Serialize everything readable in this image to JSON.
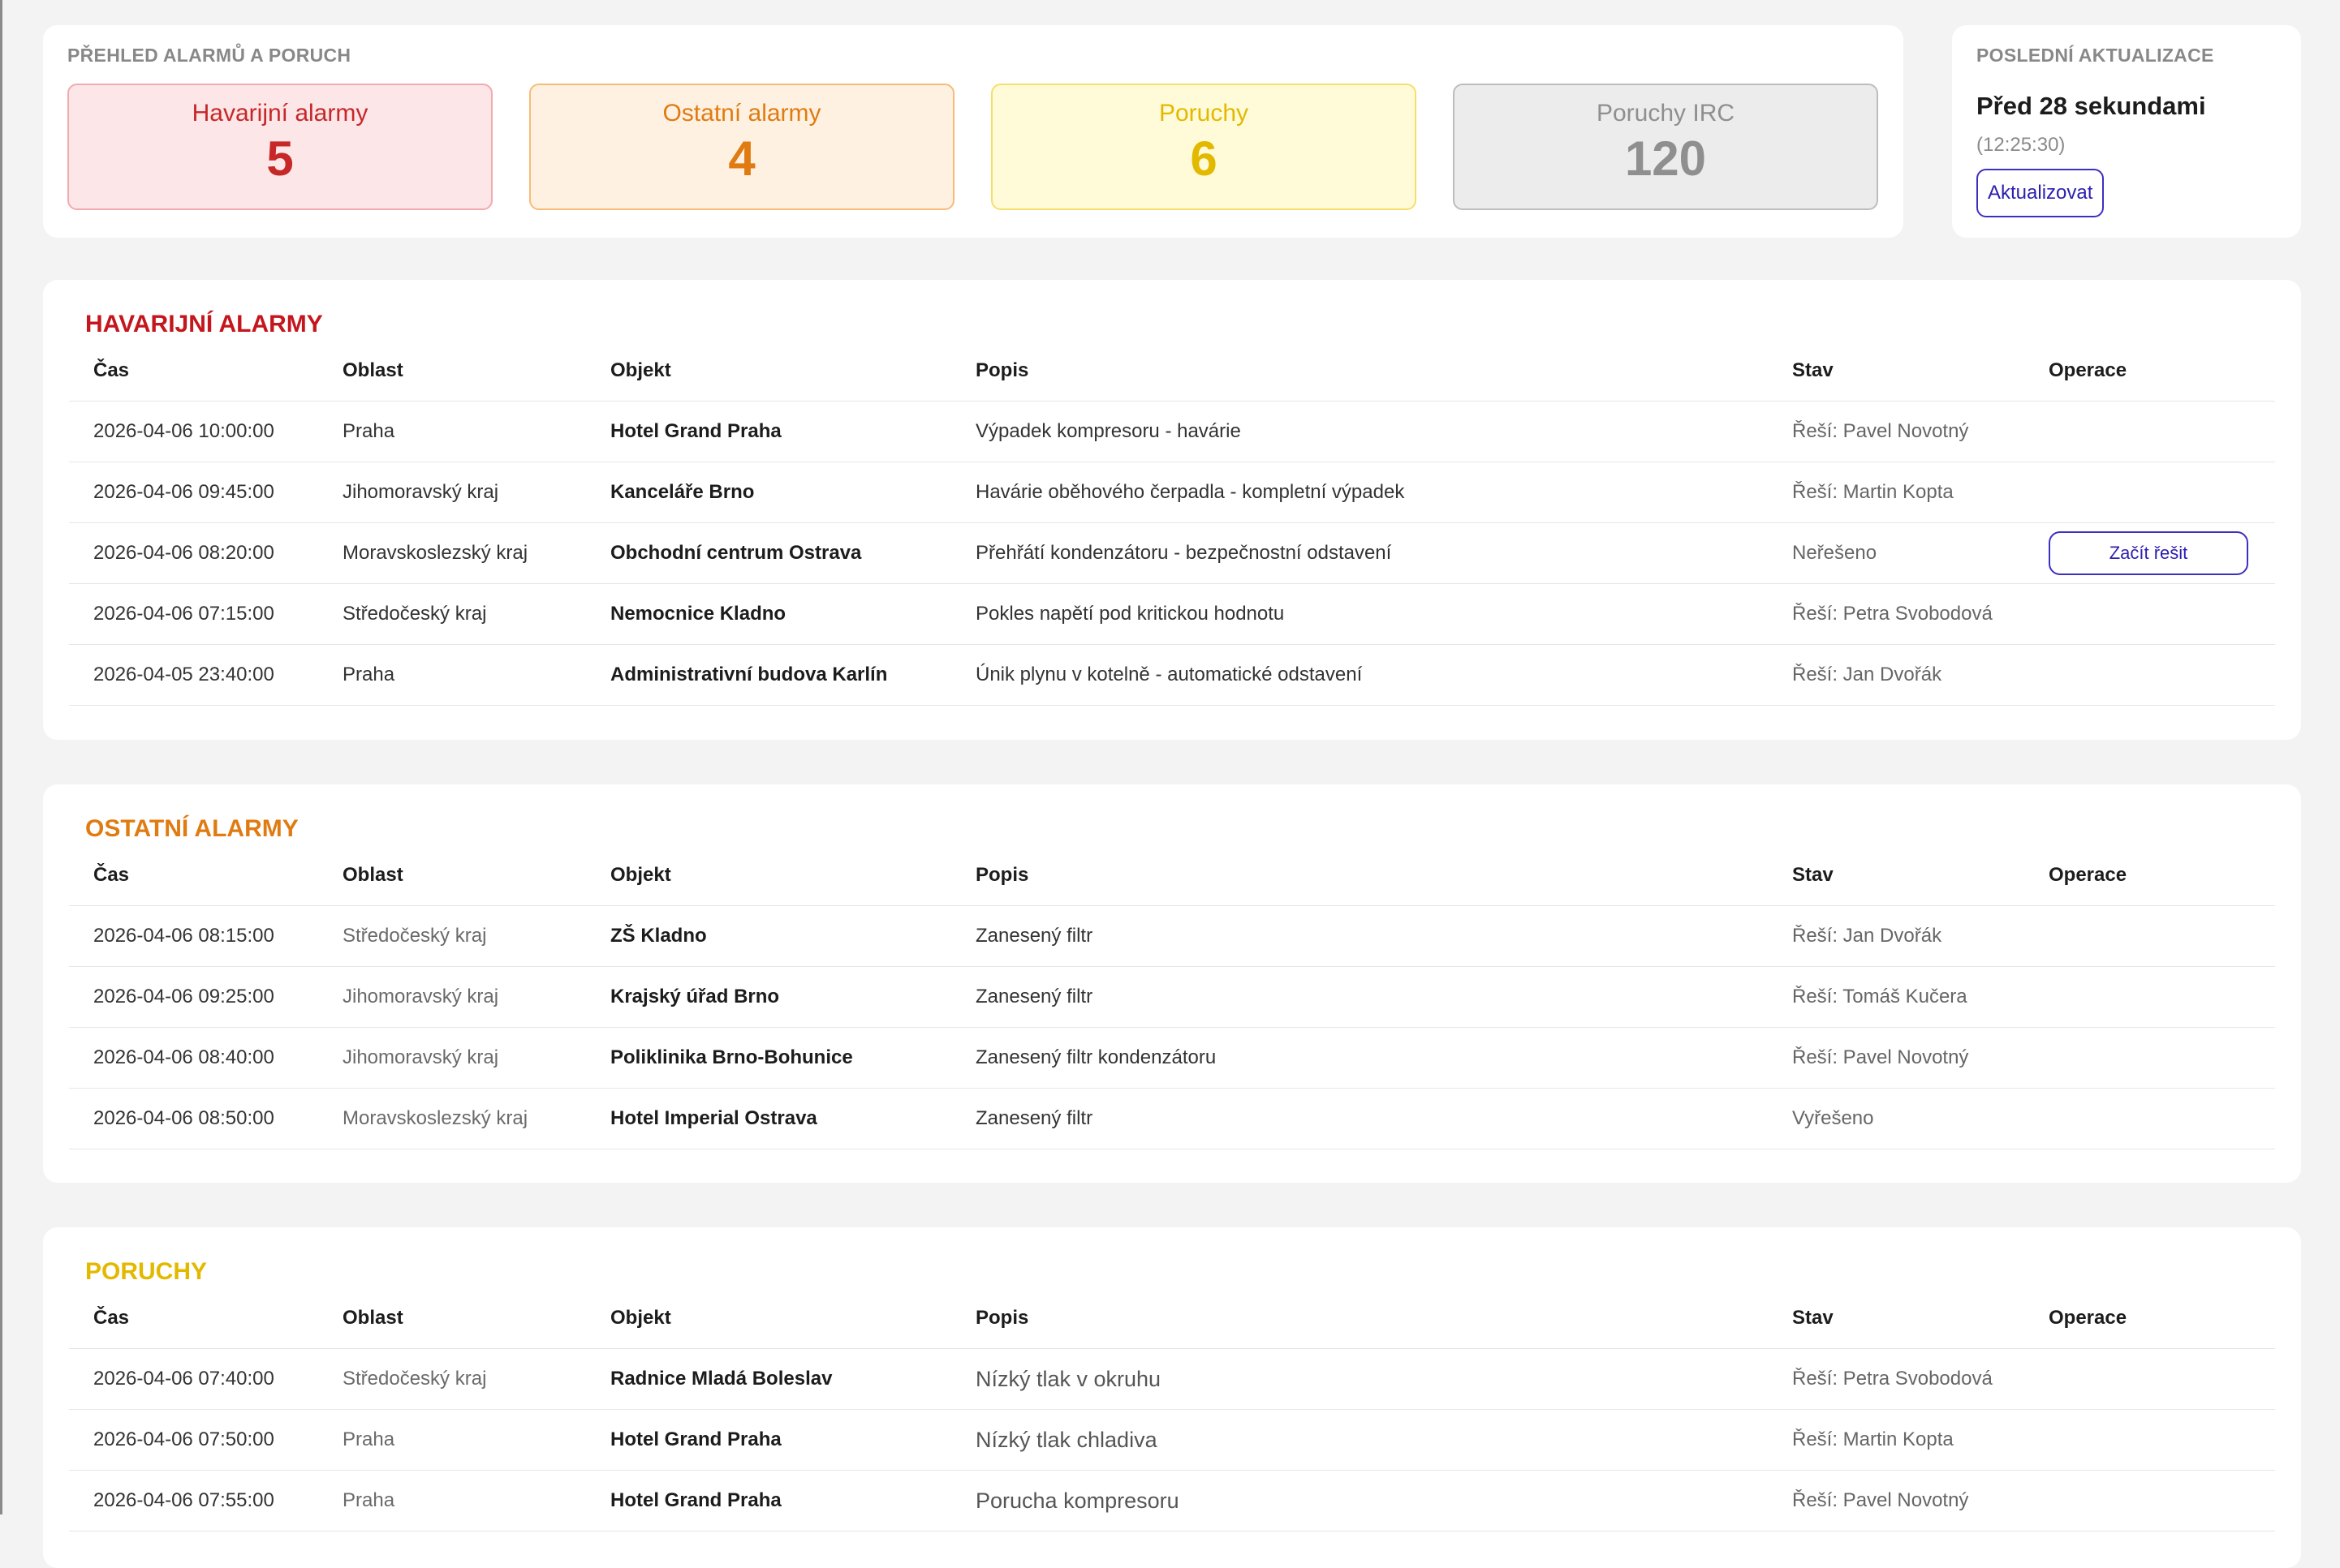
{
  "overview": {
    "caption": "PŘEHLED ALARMŮ A PORUCH",
    "counters": [
      {
        "label": "Havarijní alarmy",
        "value": "5"
      },
      {
        "label": "Ostatní alarmy",
        "value": "4"
      },
      {
        "label": "Poruchy",
        "value": "6"
      },
      {
        "label": "Poruchy IRC",
        "value": "120"
      }
    ]
  },
  "last_update": {
    "caption": "POSLEDNÍ AKTUALIZACE",
    "relative": "Před 28 sekundami",
    "time": "(12:25:30)",
    "refresh_label": "Aktualizovat"
  },
  "columns": [
    "Čas",
    "Oblast",
    "Objekt",
    "Popis",
    "Stav",
    "Operace"
  ],
  "colors": {
    "critical": "#c4161c",
    "other": "#e07b12",
    "faults": "#e3b900",
    "irc": "#8f8f8f",
    "action": "#2b1fb0"
  },
  "critical": {
    "title": "HAVARIJNÍ ALARMY",
    "rows": [
      {
        "cas": "2026-04-06 10:00:00",
        "oblast": "Praha",
        "objekt": "Hotel Grand Praha",
        "popis": "Výpadek kompresoru - havárie",
        "stav": "Řeší: Pavel Novotný",
        "operace": ""
      },
      {
        "cas": "2026-04-06 09:45:00",
        "oblast": "Jihomoravský kraj",
        "objekt": "Kanceláře Brno",
        "popis": "Havárie oběhového čerpadla - kompletní výpadek",
        "stav": "Řeší: Martin Kopta",
        "operace": ""
      },
      {
        "cas": "2026-04-06 08:20:00",
        "oblast": "Moravskoslezský kraj",
        "objekt": "Obchodní centrum Ostrava",
        "popis": "Přehřátí kondenzátoru - bezpečnostní odstavení",
        "stav": "Neřešeno",
        "operace": "Začít řešit"
      },
      {
        "cas": "2026-04-06 07:15:00",
        "oblast": "Středočeský kraj",
        "objekt": "Nemocnice Kladno",
        "popis": "Pokles napětí pod kritickou hodnotu",
        "stav": "Řeší: Petra Svobodová",
        "operace": ""
      },
      {
        "cas": "2026-04-05 23:40:00",
        "oblast": "Praha",
        "objekt": "Administrativní budova Karlín",
        "popis": "Únik plynu v kotelně - automatické odstavení",
        "stav": "Řeší: Jan Dvořák",
        "operace": ""
      }
    ]
  },
  "other": {
    "title": "OSTATNÍ ALARMY",
    "rows": [
      {
        "cas": "2026-04-06 08:15:00",
        "oblast": "Středočeský kraj",
        "objekt": "ZŠ Kladno",
        "popis": "Zanesený filtr",
        "stav": "Řeší: Jan Dvořák",
        "operace": ""
      },
      {
        "cas": "2026-04-06 09:25:00",
        "oblast": "Jihomoravský kraj",
        "objekt": "Krajský úřad Brno",
        "popis": "Zanesený filtr",
        "stav": "Řeší: Tomáš Kučera",
        "operace": ""
      },
      {
        "cas": "2026-04-06 08:40:00",
        "oblast": "Jihomoravský kraj",
        "objekt": "Poliklinika Brno-Bohunice",
        "popis": "Zanesený filtr kondenzátoru",
        "stav": "Řeší: Pavel Novotný",
        "operace": ""
      },
      {
        "cas": "2026-04-06 08:50:00",
        "oblast": "Moravskoslezský kraj",
        "objekt": "Hotel Imperial Ostrava",
        "popis": "Zanesený filtr",
        "stav": "Vyřešeno",
        "operace": ""
      }
    ]
  },
  "faults": {
    "title": "PORUCHY",
    "rows": [
      {
        "cas": "2026-04-06 07:40:00",
        "oblast": "Středočeský kraj",
        "objekt": "Radnice Mladá Boleslav",
        "popis": "Nízký tlak v okruhu",
        "stav": "Řeší: Petra Svobodová",
        "operace": ""
      },
      {
        "cas": "2026-04-06 07:50:00",
        "oblast": "Praha",
        "objekt": "Hotel Grand Praha",
        "popis": "Nízký tlak chladiva",
        "stav": "Řeší: Martin Kopta",
        "operace": ""
      },
      {
        "cas": "2026-04-06 07:55:00",
        "oblast": "Praha",
        "objekt": "Hotel Grand Praha",
        "popis": "Porucha kompresoru",
        "stav": "Řeší: Pavel Novotný",
        "operace": ""
      }
    ]
  }
}
